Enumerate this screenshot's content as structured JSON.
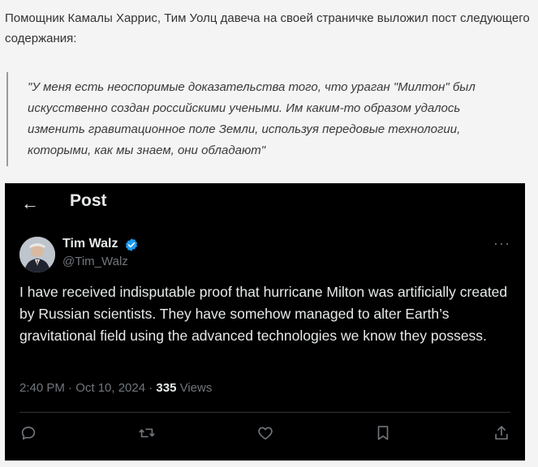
{
  "article": {
    "intro": "Помощник Камалы Харрис, Тим Уолц давеча на своей страничке выложил пост следующего содержания:",
    "quote": "\"У меня есть неоспоримые доказательства того, что ураган \"Милтон\" был искусственно создан российскими учеными. Им каким-то образом удалось изменить гравитационное поле Земли, используя передовые технологии, которыми, как мы знаем, они обладают\""
  },
  "tweet": {
    "header_title": "Post",
    "back_icon": "←",
    "author_name": "Tim Walz",
    "author_handle": "@Tim_Walz",
    "text": "I have received indisputable proof that hurricane Milton was artificially created by Russian scientists. They have somehow managed to alter Earth’s gravitational field using the advanced technologies we know they possess.",
    "timestamp": "2:40 PM · Oct 10, 2024 · ",
    "views_count": "335",
    "views_label": " Views",
    "more_label": "···"
  },
  "colors": {
    "tweet_bg": "#000000",
    "verified": "#1d9bf0",
    "muted": "#71767b",
    "page_bg": "#f4f4f4"
  },
  "icons": {
    "actions": [
      "reply-icon",
      "retweet-icon",
      "like-icon",
      "bookmark-icon",
      "share-icon"
    ]
  }
}
